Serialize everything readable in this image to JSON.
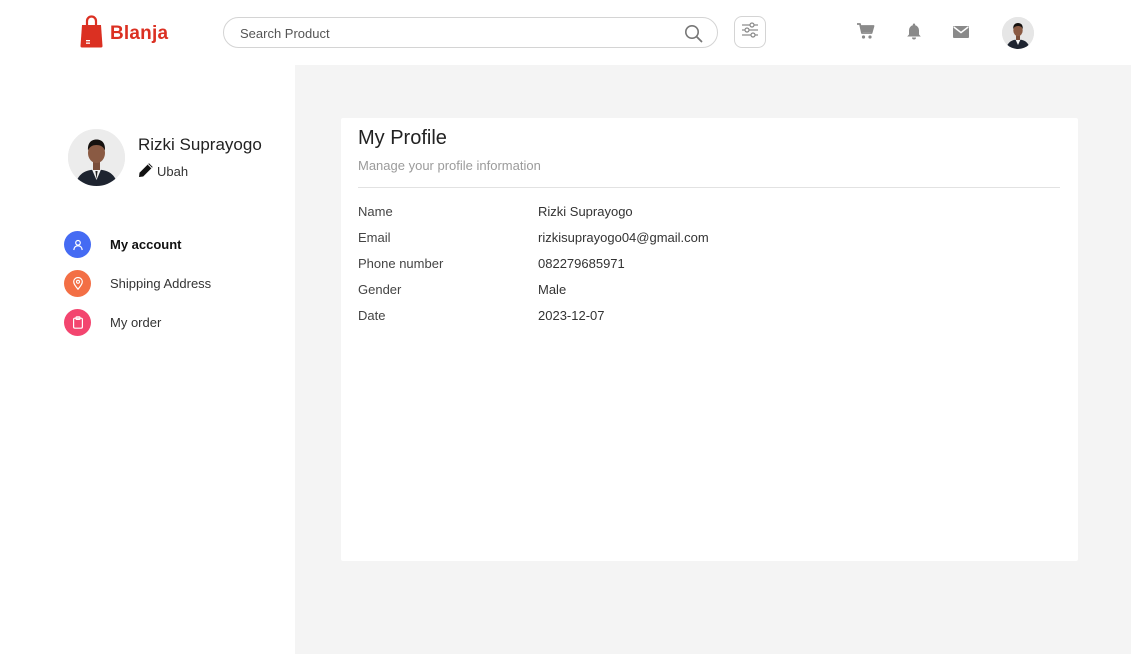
{
  "header": {
    "brand": "Blanja",
    "brand_color": "#db3022",
    "search": {
      "placeholder": "Search Product",
      "value": ""
    },
    "icons": [
      "search-icon",
      "filter-icon",
      "cart-icon",
      "bell-icon",
      "mail-icon"
    ]
  },
  "sidebar": {
    "user_name": "Rizki Suprayogo",
    "edit_label": "Ubah",
    "items": [
      {
        "label": "My account",
        "icon": "user-icon",
        "color": "#456bf3",
        "active": true
      },
      {
        "label": "Shipping Address",
        "icon": "location-icon",
        "color": "#f36f45",
        "active": false
      },
      {
        "label": "My order",
        "icon": "clipboard-icon",
        "color": "#f3456f",
        "active": false
      }
    ]
  },
  "profile": {
    "title": "My Profile",
    "subtitle": "Manage your profile information",
    "fields": [
      {
        "label": "Name",
        "value": "Rizki Suprayogo"
      },
      {
        "label": "Email",
        "value": "rizkisuprayogo04@gmail.com"
      },
      {
        "label": "Phone number",
        "value": "082279685971"
      },
      {
        "label": "Gender",
        "value": "Male"
      },
      {
        "label": "Date",
        "value": "2023-12-07"
      }
    ]
  }
}
